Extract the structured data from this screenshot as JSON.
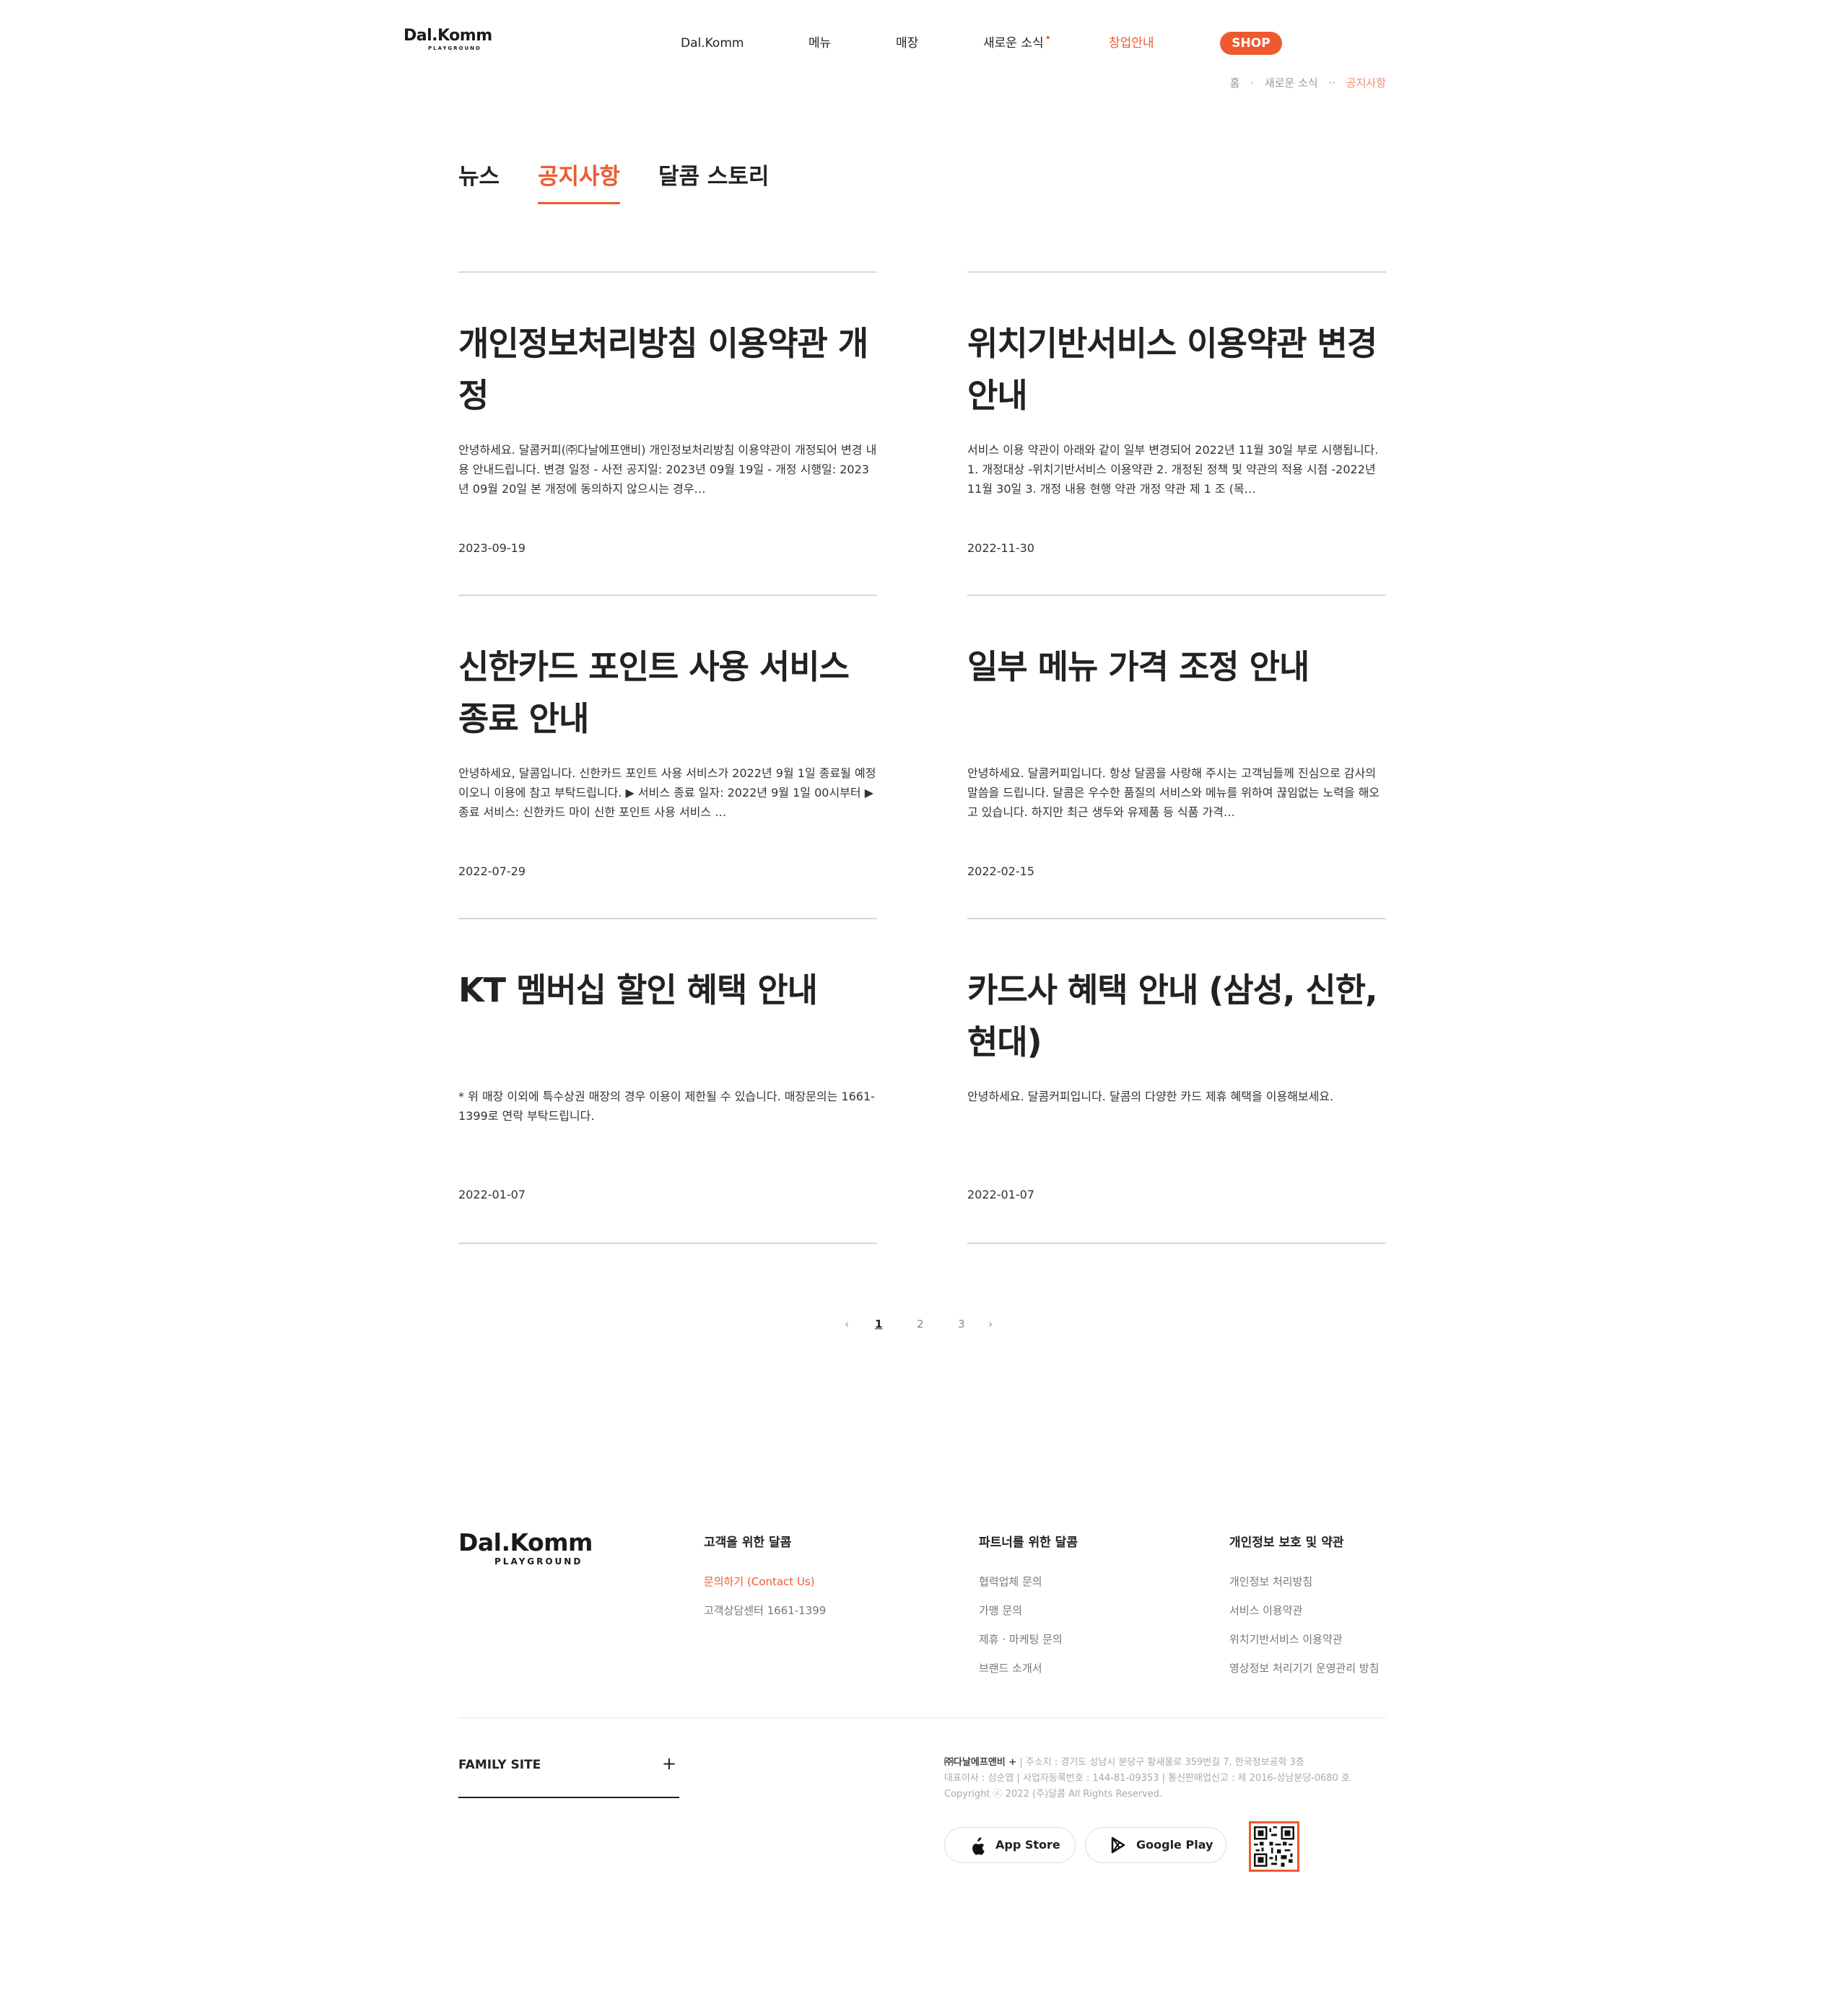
{
  "header": {
    "logo": {
      "brand": "Dal.Komm",
      "sub": "PLAYGROUND"
    },
    "nav": [
      {
        "label": "Dal.Komm"
      },
      {
        "label": "메뉴"
      },
      {
        "label": "매장"
      },
      {
        "label": "새로운 소식",
        "dot": "•"
      },
      {
        "label": "창업안내"
      }
    ],
    "shop_label": "SHOP",
    "breadcrumb": {
      "home": "홈",
      "sep1": "·",
      "section": "새로운 소식",
      "sep2": "··",
      "current": "공지사항"
    }
  },
  "tabs": [
    {
      "label": "뉴스"
    },
    {
      "label": "공지사항"
    },
    {
      "label": "달콤 스토리"
    }
  ],
  "notices": [
    {
      "title": "개인정보처리방침 이용약관 개정",
      "excerpt": "안녕하세요. 달콤커피(㈜다날에프앤비) 개인정보처리방침 이용약관이 개정되어 변경 내용 안내드립니다.     변경 일정    - 사전 공지일: 2023년 09월 19일    - 개정 시행일: 2023년 09월 20일 본 개정에 동의하지 않으시는 경우…",
      "date": "2023-09-19"
    },
    {
      "title": "위치기반서비스 이용약관 변경 안내",
      "excerpt": "      서비스 이용 약관이 아래와 같이 일부 변경되어 2022년 11월 30일 부로 시행됩니다.   1. 개정대상 -위치기반서비스 이용약관 2. 개정된 정책 및 약관의 적용 시점 -2022년 11월 30일 3. 개정 내용 현행 약관 개정 약관 제 1 조 (목…",
      "date": "2022-11-30"
    },
    {
      "title": "신한카드 포인트 사용 서비스 종료 안내",
      "excerpt": "  안녕하세요, 달콤입니다.    신한카드 포인트 사용 서비스가 2022년 9월 1일 종료될 예정이오니 이용에 참고 부탁드립니다.    ▶ 서비스 종료 일자: 2022년 9월 1일 00시부터    ▶ 종료 서비스: 신한카드 마이 신한 포인트 사용 서비스   …",
      "date": "2022-07-29"
    },
    {
      "title": "일부 메뉴 가격 조정 안내",
      "excerpt": "안녕하세요. 달콤커피입니다.   항상 달콤을 사랑해 주시는 고객님들께 진심으로 감사의 말씀을 드립니다.   달콤은 우수한 품질의 서비스와 메뉴를 위하여 끊임없는 노력을 해오고 있습니다.   하지만 최근 생두와 유제품 등 식품 가격…",
      "date": "2022-02-15"
    },
    {
      "title": "KT 멤버십 할인 혜택 안내",
      "excerpt": "* 위 매장 이외에 특수상권 매장의 경우 이용이 제한될 수 있습니다. 매장문의는 1661-1399로 연락 부탁드립니다.",
      "date": "2022-01-07"
    },
    {
      "title": "카드사 혜택 안내 (삼성, 신한, 현대)",
      "excerpt": "안녕하세요. 달콤커피입니다. 달콤의 다양한 카드 제휴 혜택을 이용해보세요.",
      "date": "2022-01-07"
    }
  ],
  "pagination": {
    "prev": "‹",
    "pages": [
      "1",
      "2",
      "3"
    ],
    "current": "1",
    "next": "›"
  },
  "footer": {
    "logo": {
      "brand": "Dal.Komm",
      "sub": "PLAYGROUND"
    },
    "columns": [
      {
        "title": "고객을 위한 달콤",
        "links": [
          "문의하기 (Contact Us)",
          "고객상담센터 1661-1399"
        ]
      },
      {
        "title": "파트너를 위한 달콤",
        "links": [
          "협력업체 문의",
          "가맹 문의",
          "제휴 · 마케팅 문의",
          "브랜드 소개서"
        ]
      },
      {
        "title": "개인정보 보호 및 약관",
        "links": [
          "개인정보 처리방침",
          "서비스 이용약관",
          "위치기반서비스 이용약관",
          "영상정보 처리기기 운영관리 방침"
        ]
      }
    ],
    "family_site": "FAMILY SITE",
    "family_plus": "+",
    "company": {
      "name": "㈜다날에프앤비 +",
      "line1": " | 주소지 : 경기도 성남시 분당구 황새울로 359번길 7, 한국정보공학 3층",
      "line2": "대표이사 : 심순엽 | 사업자등록번호 : 144-81-09353 | 통신판매업신고 : 제 2016-성남분당-0680 호",
      "line3": "Copyright ⓒ 2022 (주)달콤 All Rights Reserved."
    },
    "app_store": "App Store",
    "google_play": "Google Play"
  },
  "colors": {
    "accent": "#ee5a2e",
    "text": "#222222",
    "muted": "#777777",
    "line": "#d8d8d8"
  },
  "icons": {
    "apple": "apple-icon",
    "play": "google-play-icon",
    "qr": "qr-code-icon"
  }
}
